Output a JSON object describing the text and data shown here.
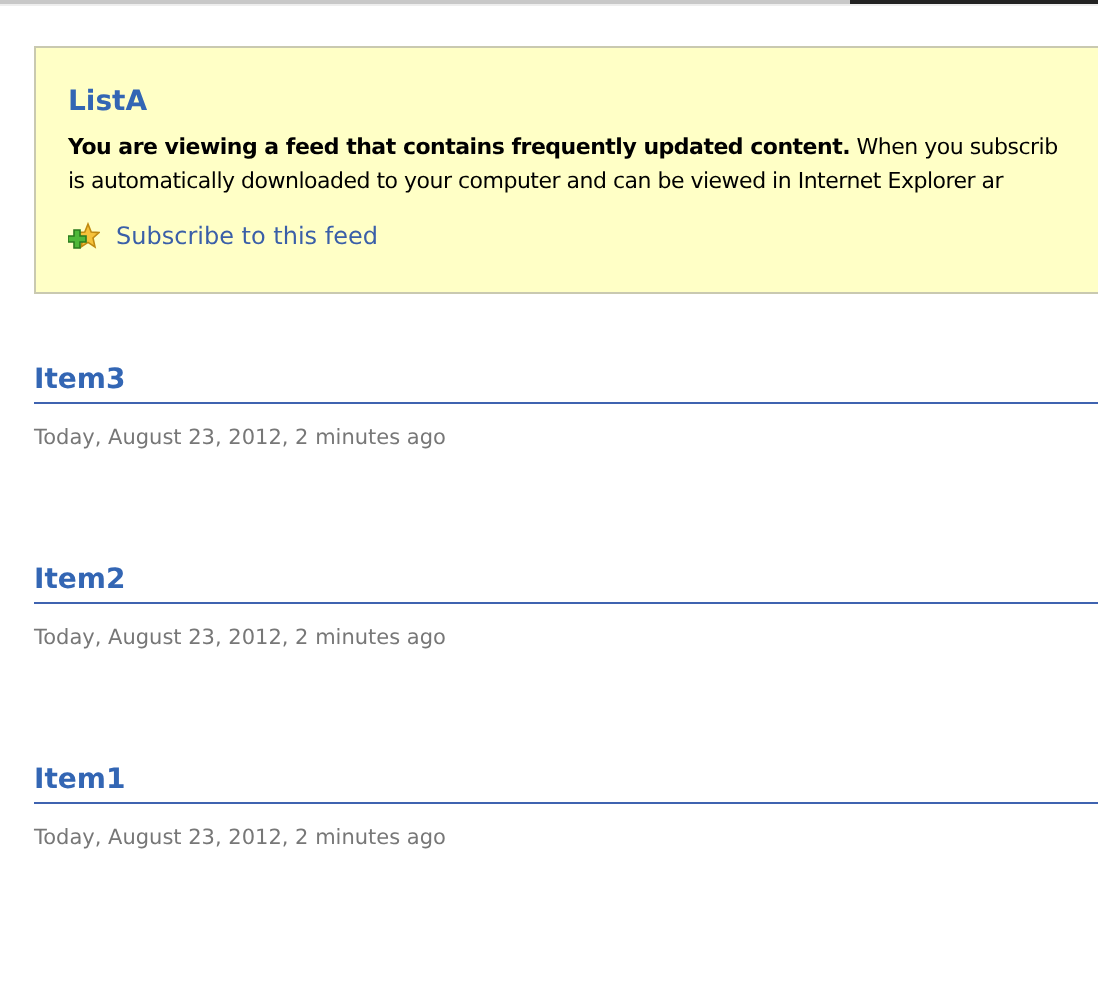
{
  "feed": {
    "title": "ListA",
    "description_lines": [
      "**You are viewing a feed that contains frequently updated content.** When you subscrib",
      "is automatically downloaded to your computer and can be viewed in Internet Explorer ar"
    ],
    "subscribe_link": "Subscribe to this feed"
  },
  "items": [
    {
      "title": "Item3",
      "date": "Today, August 23, 2012, 2 minutes ago"
    },
    {
      "title": "Item2",
      "date": "Today, August 23, 2012, 2 minutes ago"
    },
    {
      "title": "Item1",
      "date": "Today, August 23, 2012, 2 minutes ago"
    }
  ]
}
